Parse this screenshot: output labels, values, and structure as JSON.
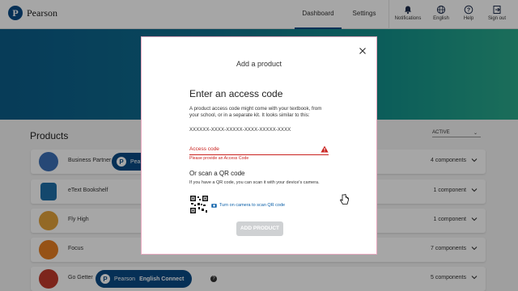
{
  "header": {
    "logo_text": "Pearson",
    "logo_letter": "P",
    "tabs": [
      {
        "label": "Dashboard",
        "active": true
      },
      {
        "label": "Settings",
        "active": false
      }
    ],
    "icon_buttons": [
      {
        "icon": "bell-icon",
        "label": "Notifications"
      },
      {
        "icon": "globe-icon",
        "label": "English"
      },
      {
        "icon": "help-icon",
        "label": "Help"
      },
      {
        "icon": "sign-out-icon",
        "label": "Sign out"
      }
    ]
  },
  "products": {
    "title": "Products",
    "status_filter": "ACTIVE",
    "items": [
      {
        "name": "Business Partner",
        "components": "4 components",
        "badge": "Pearson",
        "thumb_color": "#3b6fb6"
      },
      {
        "name": "eText Bookshelf",
        "components": "1 component",
        "thumb_color": "#1f6fa8"
      },
      {
        "name": "Fly High",
        "components": "1 component",
        "thumb_color": "#e2a23a"
      },
      {
        "name": "Focus",
        "components": "7 components",
        "thumb_color": "#e67e22"
      },
      {
        "name": "Go Getter",
        "components": "5 components",
        "badge": "English Connect",
        "badge_brand": "Pearson",
        "thumb_color": "#c0392b"
      }
    ]
  },
  "modal": {
    "title": "Add a product",
    "heading": "Enter an access code",
    "description": "A product access code might come with your textbook, from your school, or in a separate kit. It looks similar to this:",
    "sample_code": "XXXXXX-XXXX-XXXXX-XXXX-XXXXX-XXXX",
    "field_label": "Access code",
    "error": "Please provide an Access Code",
    "qr_title": "Or scan a QR code",
    "qr_description": "If you have a QR code, you can scan it with your device's camera.",
    "camera_link": "Turn on camera to scan QR code",
    "submit_label": "ADD PRODUCT",
    "submit_enabled": false
  },
  "colors": {
    "brand": "#0a4a84",
    "error": "#c9211e",
    "link": "#0a5fa8"
  }
}
